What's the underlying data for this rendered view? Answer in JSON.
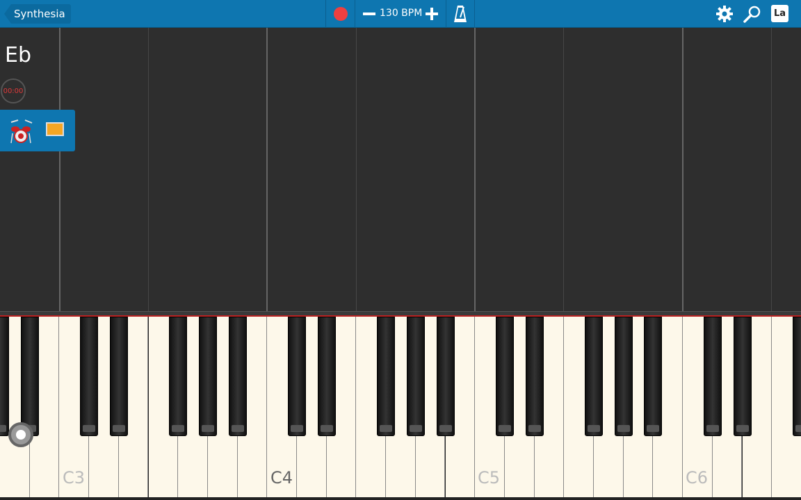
{
  "toolbar": {
    "back_label": "Synthesia",
    "record_icon": "record-icon",
    "tempo": "130 BPM",
    "metronome_icon": "metronome-icon",
    "settings_icon": "gear-icon",
    "search_icon": "magnifier-icon",
    "labels_button": "La"
  },
  "roll": {
    "key_signature": "Eb",
    "timer": "00:00"
  },
  "track": {
    "instrument_icon": "drum-kit-icon",
    "color": "#f5a623"
  },
  "keyboard": {
    "labels": [
      "C3",
      "C4",
      "C5",
      "C6"
    ]
  },
  "colors": {
    "accent": "#0e76b0",
    "record": "#ef4040"
  }
}
